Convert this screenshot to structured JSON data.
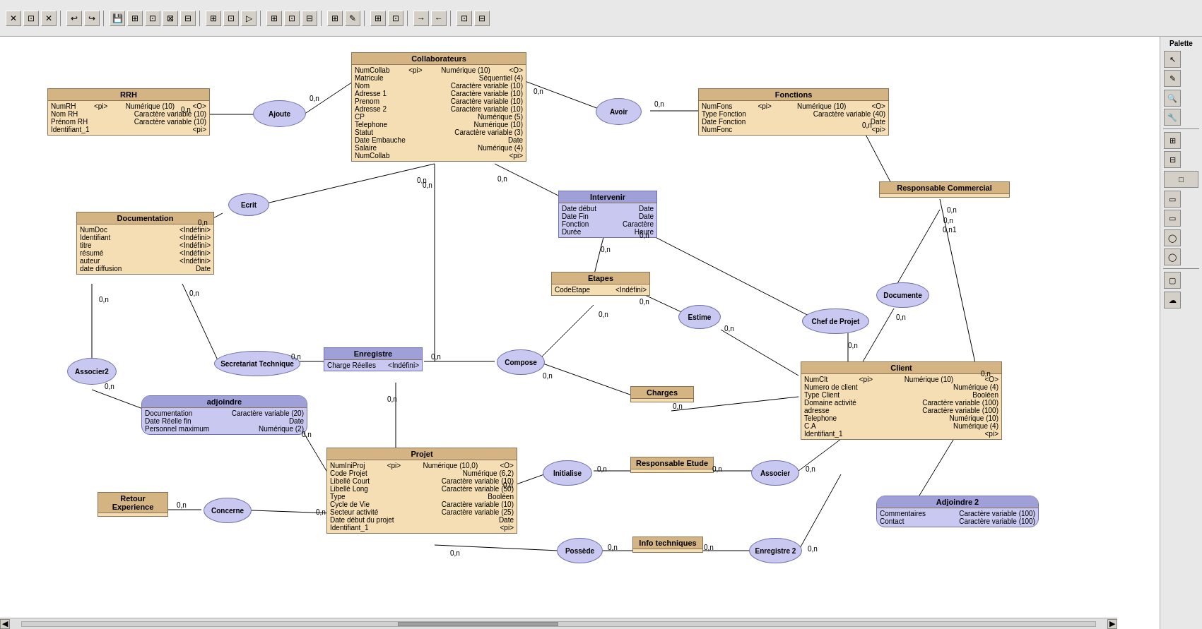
{
  "toolbar": {
    "buttons": [
      "✕",
      "⊡",
      "✕",
      "↩",
      "↪",
      "🖫",
      "⊞",
      "⊡",
      "⊠",
      "⊟",
      "⊞",
      "⊡",
      "▷",
      "⊞",
      "⊡",
      "⊟",
      "⊞",
      "⊡",
      "⊟",
      "✎",
      "⊞",
      "⊡",
      "→",
      "←",
      "⊡",
      "⊟"
    ]
  },
  "palette": {
    "title": "Palette",
    "buttons": [
      "↖",
      "✎",
      "🔍",
      "🔧",
      "⊞",
      "⊟",
      "◻",
      "◯",
      "◻",
      "◻",
      "◯",
      "◯",
      "◻",
      "◯",
      "☁"
    ]
  },
  "entities": {
    "rrh": {
      "title": "RRH",
      "fields": [
        {
          "name": "NumRH",
          "key": "<pi>",
          "type": "Numérique (10)",
          "extra": "<O>"
        },
        {
          "name": "Nom RH",
          "type": "Caractère variable (10)"
        },
        {
          "name": "Prénom RH",
          "type": "Caractère variable (10)"
        },
        {
          "name": "Identifiant_1",
          "key": "<pi>"
        }
      ]
    },
    "collaborateurs": {
      "title": "Collaborateurs",
      "fields": [
        {
          "name": "NumCollab",
          "key": "<pi>",
          "type": "Numérique (10)",
          "extra": "<O>"
        },
        {
          "name": "Matricule",
          "type": "Séquentiel (4)"
        },
        {
          "name": "Nom",
          "type": "Caractère variable (10)"
        },
        {
          "name": "Adresse 1",
          "type": "Caractère variable (10)"
        },
        {
          "name": "Prenom",
          "type": "Caractère variable (10)"
        },
        {
          "name": "Adresse 2",
          "type": "Caractère variable (10)"
        },
        {
          "name": "CP",
          "type": "Numérique (5)"
        },
        {
          "name": "Telephone",
          "type": "Numérique (10)"
        },
        {
          "name": "Statut",
          "type": "Caractère variable (3)"
        },
        {
          "name": "Date Embauche",
          "type": "Date"
        },
        {
          "name": "Salaire",
          "type": "Numérique (4)"
        },
        {
          "name": "NumCollab",
          "key": "<pi>"
        }
      ]
    },
    "fonctions": {
      "title": "Fonctions",
      "fields": [
        {
          "name": "NumFons",
          "key": "<pi>",
          "type": "Numérique (10)",
          "extra": "<O>"
        },
        {
          "name": "Type Fonction",
          "type": "Caractère variable (40)"
        },
        {
          "name": "Date Fonction",
          "type": "Date"
        },
        {
          "name": "NumFonc",
          "key": "<pi>"
        }
      ]
    },
    "documentation": {
      "title": "Documentation",
      "fields": [
        {
          "name": "NumDoc",
          "type": "<Indéfini>"
        },
        {
          "name": "Identifiant",
          "type": "<Indéfini>"
        },
        {
          "name": "titre",
          "type": "<Indéfini>"
        },
        {
          "name": "résumé",
          "type": "<Indéfini>"
        },
        {
          "name": "auteur",
          "type": "<Indéfini>"
        },
        {
          "name": "date diffusion",
          "type": "Date"
        }
      ]
    },
    "etapes": {
      "title": "Etapes",
      "fields": [
        {
          "name": "CodeEtape",
          "type": "<Indéfini>"
        }
      ]
    },
    "client": {
      "title": "Client",
      "fields": [
        {
          "name": "NumClt",
          "key": "<pi>",
          "type": "Numérique (10)",
          "extra": "<O>"
        },
        {
          "name": "Numero de client",
          "type": "Numérique (4)"
        },
        {
          "name": "Type Client",
          "type": "Booléen"
        },
        {
          "name": "Domaine activité",
          "type": "Caractère variable (100)"
        },
        {
          "name": "adresse",
          "type": "Caractère variable (100)"
        },
        {
          "name": "Telephone",
          "type": "Numérique (10)"
        },
        {
          "name": "C.A",
          "type": "Numérique (4)"
        },
        {
          "name": "Identifiant_1",
          "key": "<pi>"
        }
      ]
    },
    "projet": {
      "title": "Projet",
      "fields": [
        {
          "name": "NumIniProj",
          "key": "<pi>",
          "type": "Numérique (10,0)",
          "extra": "<O>"
        },
        {
          "name": "Code Projet",
          "type": "Numérique (6,2)"
        },
        {
          "name": "Libellé Court",
          "type": "Caractère variable (10)"
        },
        {
          "name": "Libellé Long",
          "type": "Caractère variable (50)"
        },
        {
          "name": "Type",
          "type": "Booléen"
        },
        {
          "name": "Cycle de Vie",
          "type": "Caractère variable (10)"
        },
        {
          "name": "Secteur activité",
          "type": "Caractère variable (25)"
        },
        {
          "name": "Date début du projet",
          "type": "Date"
        },
        {
          "name": "Identifiant_1",
          "key": "<pi>"
        }
      ]
    },
    "charges": {
      "title": "Charges",
      "fields": []
    },
    "info_techniques": {
      "title": "Info techniques",
      "fields": []
    },
    "responsable_commercial": {
      "title": "Responsable Commercial",
      "fields": []
    },
    "responsable_etude": {
      "title": "Responsable Etude",
      "fields": []
    },
    "retour_experience": {
      "title": "Retour Experience",
      "fields": []
    }
  },
  "relations": {
    "ajoute": "Ajoute",
    "avoir": "Avoir",
    "ecrit": "Ecrit",
    "intervenir": "Intervenir",
    "secretariat_technique": "Secretariat Technique",
    "enregistre": "Enregistre",
    "associer2": "Associer2",
    "compose": "Compose",
    "estime": "Estime",
    "chef_de_projet": "Chef de Projet",
    "documente": "Documente",
    "initialise": "Initialise",
    "associer": "Associer",
    "possede": "Possède",
    "enregistre2": "Enregistre 2",
    "concerne": "Concerne",
    "adjoindre2": "Adjoindre 2"
  },
  "assoc_boxes": {
    "enregistre_box": {
      "label": "Enregistre",
      "field": "Charge Réelles  <Indéfini>"
    },
    "adjoindre_box": {
      "label": "adjoindre",
      "fields": [
        {
          "name": "Documentation",
          "type": "Caractère variable (20)"
        },
        {
          "name": "Date Réelle fin",
          "type": "Date"
        },
        {
          "name": "Personnel maximum",
          "type": "Numérique (2)"
        }
      ]
    },
    "intervenir_box": {
      "label": "Intervenir",
      "fields": [
        {
          "name": "Date début",
          "type": "Date"
        },
        {
          "name": "Date Fin",
          "type": "Date"
        },
        {
          "name": "Fonction",
          "type": "Caractère"
        },
        {
          "name": "Durée",
          "type": "Heure"
        }
      ]
    },
    "adjoindre2_box": {
      "label": "Adjoindre 2",
      "fields": [
        {
          "name": "Commentaires",
          "type": "Caractère variable (100)"
        },
        {
          "name": "Contact",
          "type": "Caractère variable (100)"
        }
      ]
    }
  }
}
